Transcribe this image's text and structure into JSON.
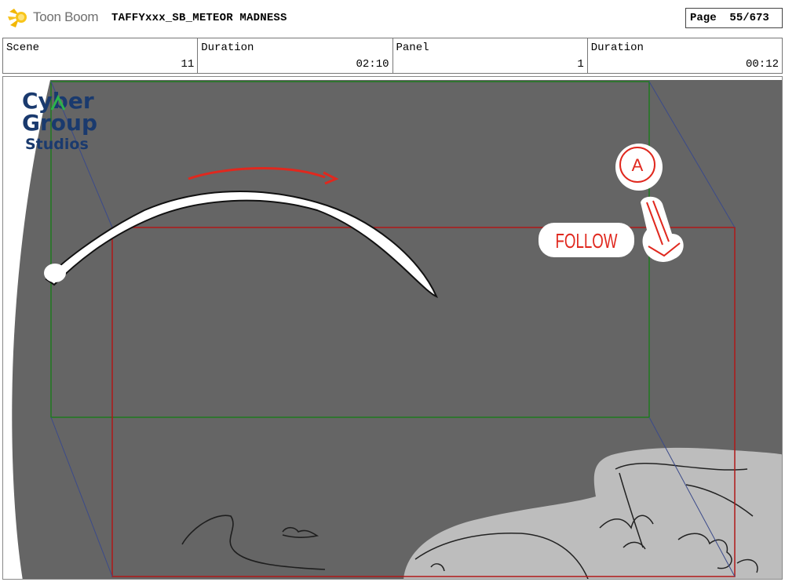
{
  "header": {
    "app_name": "Toon Boom",
    "document_title": "TAFFYxxx_SB_METEOR MADNESS",
    "page_label": "Page",
    "page_value": "55/673"
  },
  "info_bar": {
    "scene_label": "Scene",
    "scene_value": "11",
    "scene_duration_label": "Duration",
    "scene_duration_value": "02:10",
    "panel_label": "Panel",
    "panel_value": "1",
    "panel_duration_label": "Duration",
    "panel_duration_value": "00:12"
  },
  "panel_artwork": {
    "watermark_line1": "Cyber",
    "watermark_line2": "Group",
    "watermark_line3": "Studios",
    "annotation_circle": "A",
    "annotation_text": "FOLLOW"
  },
  "colors": {
    "background_gray": "#656565",
    "camera_start_frame": "#1e7a1e",
    "camera_end_frame": "#b01818",
    "annotation_red": "#e0281e",
    "watermark_blue": "#1a3a6e",
    "foliage_gray": "#bdbdbd"
  }
}
